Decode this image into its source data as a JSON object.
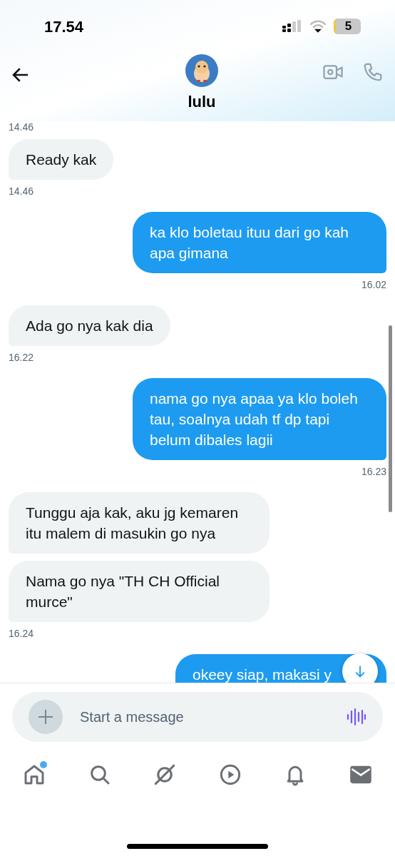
{
  "status_bar": {
    "time": "17.54",
    "battery": "5"
  },
  "header": {
    "name": "lulu"
  },
  "messages": [
    {
      "kind": "time_only",
      "time": "14.46"
    },
    {
      "kind": "incoming",
      "text": "Ready kak",
      "time": "14.46"
    },
    {
      "kind": "outgoing",
      "text": "ka klo boletau ituu dari go kah apa gimana",
      "time": "16.02"
    },
    {
      "kind": "incoming",
      "text": "Ada go nya kak dia",
      "time": "16.22"
    },
    {
      "kind": "outgoing",
      "text": "nama go nya apaa ya klo boleh tau, soalnya udah tf dp tapi belum dibales lagii",
      "time": "16.23"
    },
    {
      "kind": "incoming",
      "text": "Tunggu aja kak, aku jg kemaren itu malem di masukin go nya"
    },
    {
      "kind": "incoming",
      "text": "Nama go nya \"TH CH Official murce\"",
      "time": "16.24"
    },
    {
      "kind": "outgoing",
      "text": "okeey siap, makasi y"
    }
  ],
  "composer": {
    "placeholder": "Start a message"
  },
  "nav": [
    {
      "kind": "home",
      "selected": false,
      "dot": true
    },
    {
      "kind": "search",
      "selected": false,
      "dot": false
    },
    {
      "kind": "grok",
      "selected": false,
      "dot": false
    },
    {
      "kind": "video",
      "selected": false,
      "dot": false
    },
    {
      "kind": "bell",
      "selected": false,
      "dot": false
    },
    {
      "kind": "mail",
      "selected": true,
      "dot": false
    }
  ]
}
